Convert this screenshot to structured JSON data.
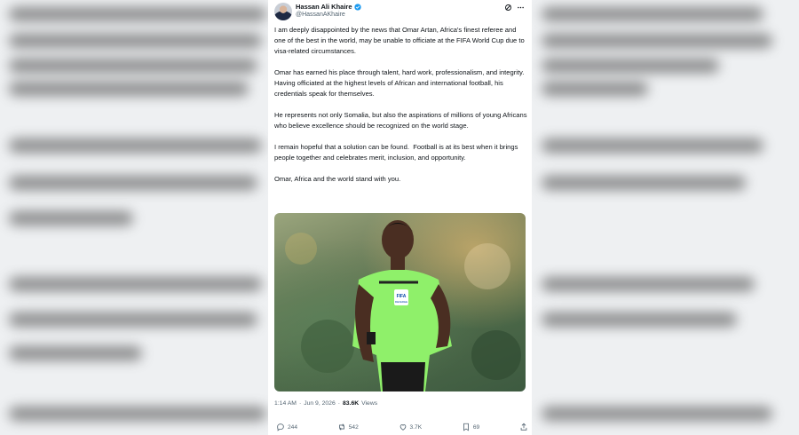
{
  "author": {
    "name": "Hassan Ali Khaire",
    "handle": "@HassanAKhaire"
  },
  "icons": {
    "verified": "verified-badge-icon",
    "grok": "grok-icon",
    "more": "more-icon",
    "reply": "reply-icon",
    "repost": "repost-icon",
    "like": "like-icon",
    "bookmark": "bookmark-icon",
    "share": "share-icon"
  },
  "colors": {
    "verified": "#1d9bf0",
    "text": "#0f1419",
    "muted": "#536471"
  },
  "tweet": {
    "paragraphs": [
      "I am deeply disappointed by the news that Omar Artan, Africa's finest referee and one of the best in the world, may be unable to officiate at the FIFA World Cup due to visa-related circumstances.",
      "Omar has earned his place through talent, hard work, professionalism, and integrity. Having officiated at the highest levels of African and international football, his credentials speak for themselves.",
      "He represents not only Somalia, but also the aspirations of millions of young Africans who believe excellence should be recognized on the world stage.",
      "I remain hopeful that a solution can be found.  Football is at its best when it brings people together and celebrates merit, inclusion, and opportunity.",
      "Omar, Africa and the world stand with you."
    ],
    "time": "1:14 AM",
    "separator": "·",
    "date": "Jun 9, 2026",
    "views_count": "83.6K",
    "views_label": "Views"
  },
  "photo": {
    "badge": "FIFA",
    "badge_sub": "REFEREE"
  },
  "actions": {
    "replies": "244",
    "reposts": "542",
    "likes": "3.7K",
    "bookmarks": "69"
  }
}
